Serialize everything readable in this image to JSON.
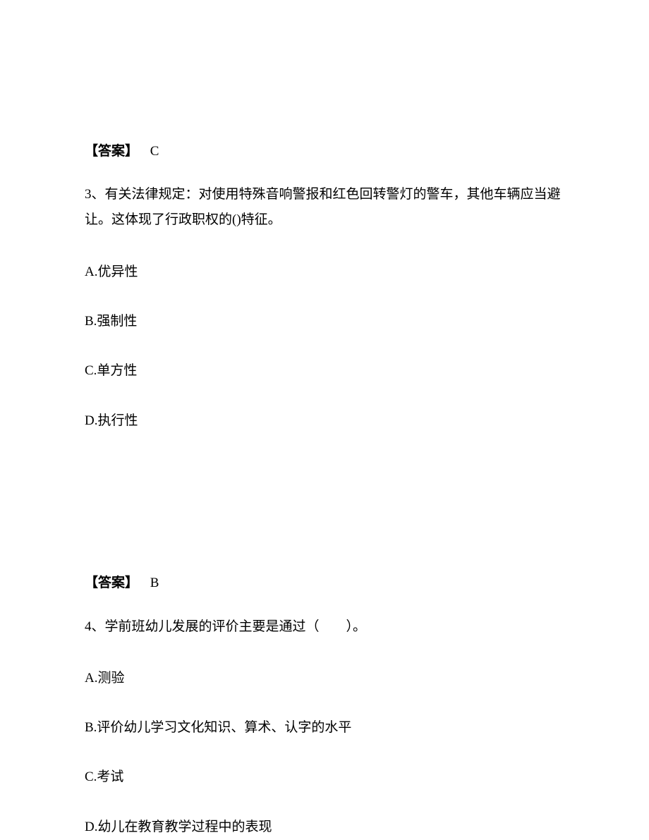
{
  "answer1": {
    "label": "【答案】",
    "value": "C"
  },
  "question3": {
    "number": "3、",
    "stem": "有关法律规定：对使用特殊音响警报和红色回转警灯的警车，其他车辆应当避让。这体现了行政职权的()特征。",
    "options": {
      "A": "A.优异性",
      "B": "B.强制性",
      "C": "C.单方性",
      "D": "D.执行性"
    }
  },
  "answer2": {
    "label": "【答案】",
    "value": "B"
  },
  "question4": {
    "number": "4、",
    "stem": "学前班幼儿发展的评价主要是通过（　　）。",
    "options": {
      "A": "A.测验",
      "B": "B.评价幼儿学习文化知识、算术、认字的水平",
      "C": "C.考试",
      "D": "D.幼儿在教育教学过程中的表现"
    }
  }
}
